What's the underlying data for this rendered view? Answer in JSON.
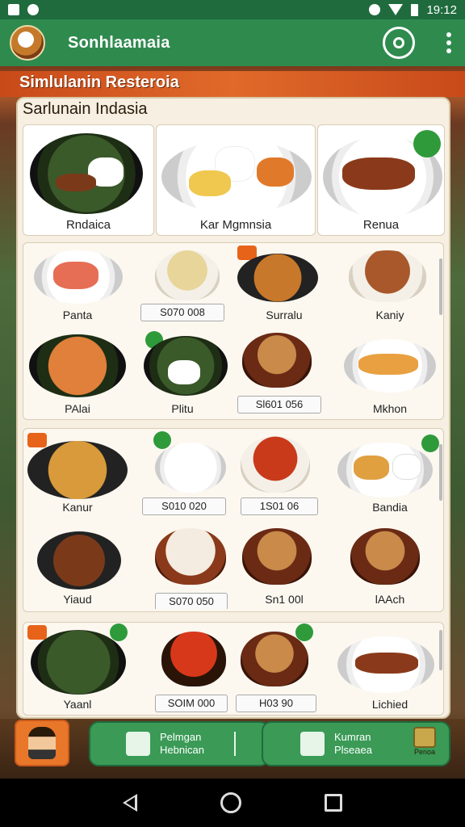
{
  "status_bar": {
    "time": "19:12"
  },
  "app_bar": {
    "title": "Sonhlaamaia"
  },
  "banner": {
    "text": "Simlulanin Resteroia"
  },
  "menu": {
    "title": "Sarlunain Indasia",
    "featured": [
      {
        "label": "Rndaica"
      },
      {
        "label": "Kar Mgmnsia"
      },
      {
        "label": "Renua"
      }
    ],
    "section_a": {
      "row1": [
        {
          "label": "Panta"
        },
        {
          "price": "S070 008"
        },
        {
          "label": "Surralu"
        },
        {
          "label": "Kaniy"
        }
      ],
      "row2": [
        {
          "label": "PAlai"
        },
        {
          "label": "Plitu"
        },
        {
          "price": "Sl601 056"
        },
        {
          "label": "Mkhon"
        }
      ]
    },
    "section_b": {
      "row1": [
        {
          "label": "Kanur"
        },
        {
          "price": "S010 020"
        },
        {
          "price": "1S01 06"
        },
        {
          "label": "Bandia"
        }
      ],
      "row2": [
        {
          "label": "Yiaud"
        },
        {
          "price": "S070 050"
        },
        {
          "label": "Sn1 00l"
        },
        {
          "label": "lAAch"
        }
      ]
    },
    "section_c": [
      {
        "label": "Yaanl"
      },
      {
        "price": "SOIM 000"
      },
      {
        "price": "H03 90"
      },
      {
        "label": "Lichied"
      }
    ]
  },
  "bottom_nav": {
    "left_button": {
      "line1": "Pelmgan",
      "line2": "Hebnican"
    },
    "right_button": {
      "line1": "Kumran",
      "line2": "Plseaea"
    },
    "corner_label": "Penoa"
  },
  "icons": [
    "home-icon",
    "status-icon",
    "chat-icon",
    "menu-icon",
    "back-icon",
    "home-nav-icon",
    "recent-icon"
  ],
  "colors": {
    "primary_green": "#2f8a4e",
    "banner_orange": "#d85a22",
    "panel_bg": "#f6efe2"
  }
}
